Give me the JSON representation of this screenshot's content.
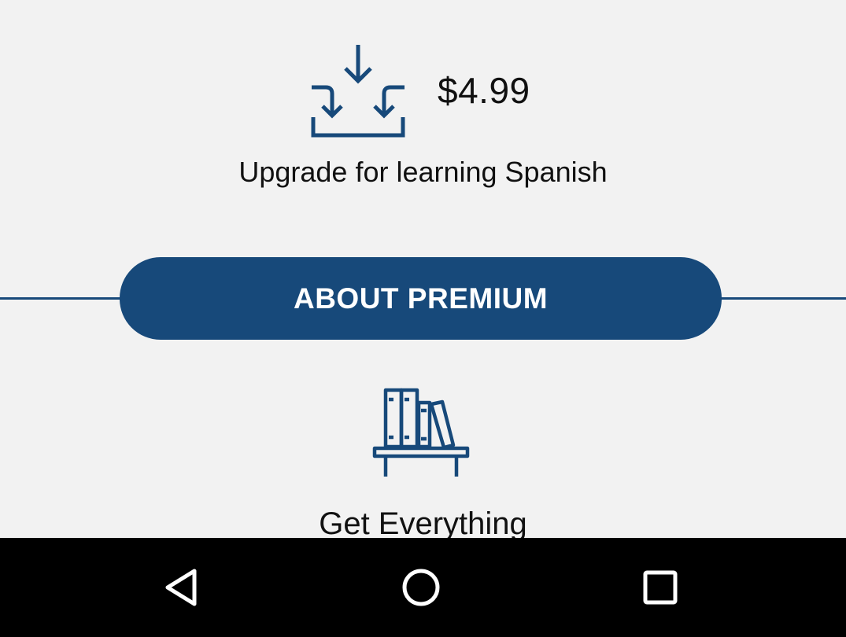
{
  "upgrade": {
    "price": "$4.99",
    "label": "Upgrade for learning Spanish",
    "icon": "download-tray-icon"
  },
  "about_button": {
    "label": "ABOUT PREMIUM"
  },
  "everything": {
    "label": "Get Everything",
    "icon": "bookshelf-icon"
  },
  "navbar": {
    "back_icon": "back-triangle-icon",
    "home_icon": "home-circle-icon",
    "recent_icon": "recent-apps-square-icon"
  },
  "colors": {
    "accent": "#17497a",
    "background": "#f2f2f2",
    "navbar": "#000000"
  }
}
